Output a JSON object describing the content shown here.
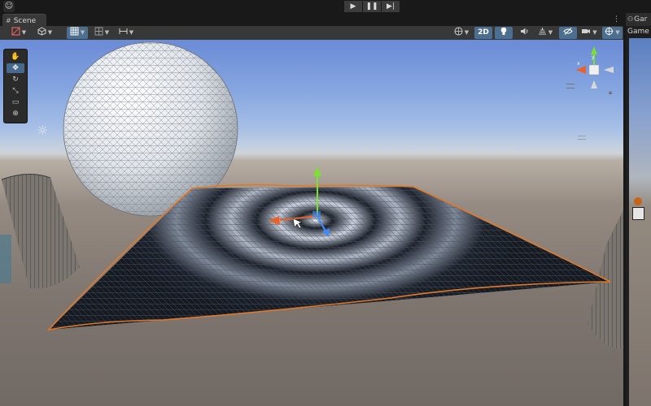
{
  "topbar": {
    "account_icon": "account-icon",
    "play_controls": [
      {
        "name": "play-button",
        "icon": "play-icon",
        "glyph": "▶"
      },
      {
        "name": "pause-button",
        "icon": "pause-icon",
        "glyph": "❚❚"
      },
      {
        "name": "step-button",
        "icon": "step-icon",
        "glyph": "▶|"
      }
    ]
  },
  "scene_tab": {
    "label": "Scene",
    "icon": "hash-icon",
    "menu_glyph": "⋮"
  },
  "scene_toolbar": {
    "left": [
      {
        "name": "shading-mode-dropdown",
        "icon": "shading-icon",
        "active": false
      },
      {
        "name": "render-mode-dropdown",
        "icon": "cube-icon",
        "active": false
      },
      {
        "name": "grid-snap-dropdown",
        "icon": "grid-icon",
        "active": true
      },
      {
        "name": "increment-snap-dropdown",
        "icon": "snap-icon",
        "active": false
      },
      {
        "name": "view-options-dropdown",
        "icon": "ruler-icon",
        "active": false
      }
    ],
    "right": [
      {
        "name": "draw-mode-dropdown",
        "icon": "globe-icon",
        "active": false
      },
      {
        "name": "2d-toggle",
        "label": "2D",
        "active": true
      },
      {
        "name": "lighting-toggle",
        "icon": "lightbulb-icon",
        "active": true
      },
      {
        "name": "audio-toggle",
        "icon": "audio-icon",
        "active": false
      },
      {
        "name": "effects-dropdown",
        "icon": "effects-icon",
        "active": false
      },
      {
        "name": "hidden-objects-toggle",
        "icon": "eye-slash-icon",
        "active": true
      },
      {
        "name": "camera-dropdown",
        "icon": "camera-icon",
        "active": false
      },
      {
        "name": "gizmos-dropdown",
        "icon": "gizmo-icon",
        "active": true
      }
    ]
  },
  "tools": [
    {
      "name": "hand-tool",
      "icon": "hand-icon",
      "glyph": "✋",
      "selected": false
    },
    {
      "name": "move-tool",
      "icon": "move-icon",
      "glyph": "✥",
      "selected": true
    },
    {
      "name": "rotate-tool",
      "icon": "rotate-icon",
      "glyph": "↻",
      "selected": false
    },
    {
      "name": "scale-tool",
      "icon": "scale-icon",
      "glyph": "⤡",
      "selected": false
    },
    {
      "name": "rect-tool",
      "icon": "rect-transform-icon",
      "glyph": "▭",
      "selected": false
    },
    {
      "name": "transform-tool",
      "icon": "transform-icon",
      "glyph": "⊕",
      "selected": false
    }
  ],
  "game_tab": {
    "tab_label": "Gar",
    "icon": "gamepad-icon",
    "label": "Game"
  },
  "colors": {
    "selection_outline": "#e0782a",
    "axis_x": "#e8622a",
    "axis_y": "#7be030",
    "axis_z": "#3c8cff",
    "active_button": "#4d6f8f"
  }
}
